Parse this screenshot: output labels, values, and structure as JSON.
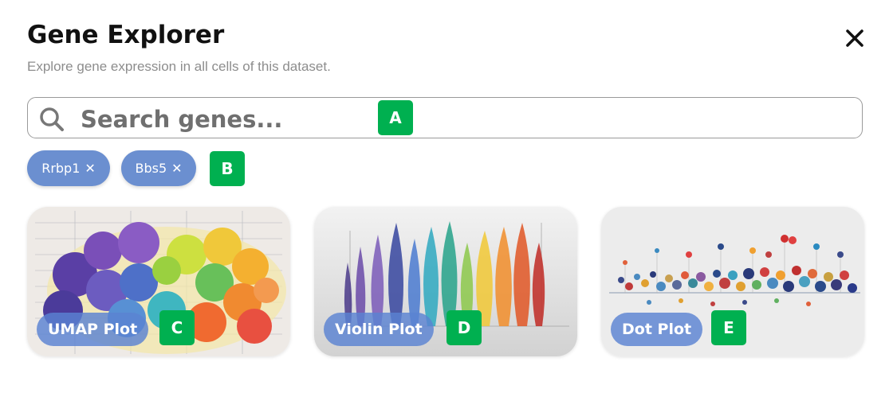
{
  "dialog": {
    "title": "Gene Explorer",
    "subtitle": "Explore gene expression in all cells of this dataset.",
    "close_icon": "close-icon"
  },
  "search": {
    "placeholder": "Search genes...",
    "value": "",
    "icon": "search-icon"
  },
  "selected_genes": [
    {
      "label": "Rrbp1",
      "remove": "✕"
    },
    {
      "label": "Bbs5",
      "remove": "✕"
    }
  ],
  "plots": [
    {
      "label": "UMAP Plot"
    },
    {
      "label": "Violin Plot"
    },
    {
      "label": "Dot Plot"
    }
  ],
  "markers": [
    "A",
    "B",
    "C",
    "D",
    "E"
  ],
  "colors": {
    "chip": "#6b8fd0",
    "marker": "#00b050",
    "title": "#111111",
    "subtitle": "#8d8d8d"
  }
}
